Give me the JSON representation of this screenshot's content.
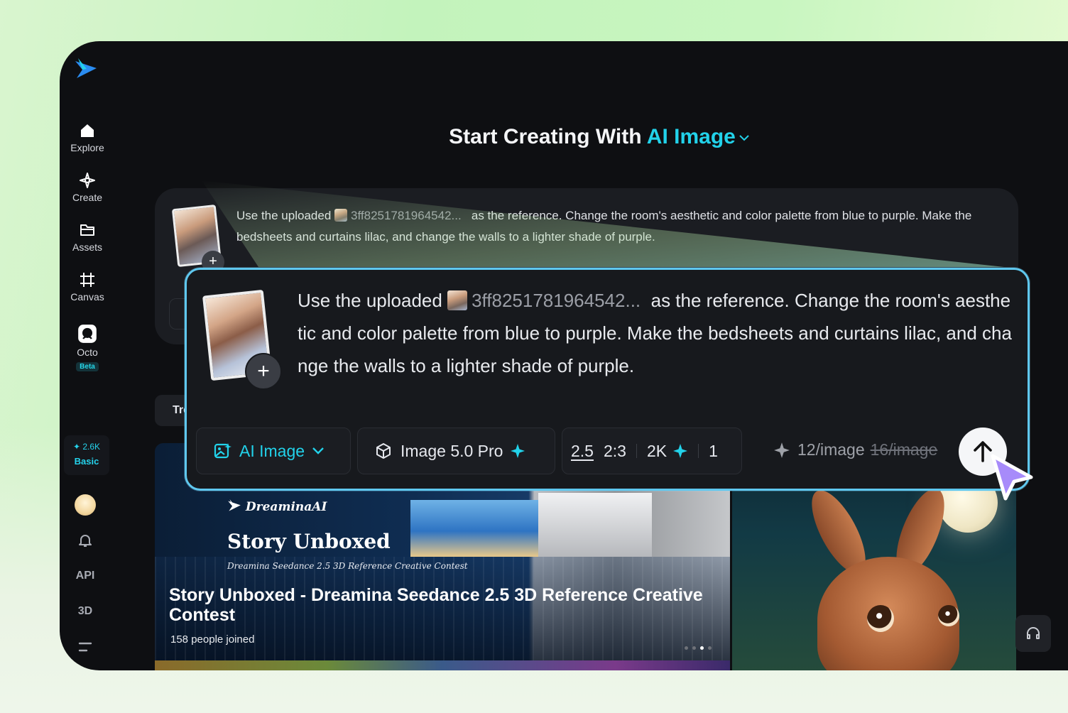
{
  "sidebar": {
    "nav": [
      {
        "label": "Explore",
        "icon": "home-icon"
      },
      {
        "label": "Create",
        "icon": "sparkle-outline-icon"
      },
      {
        "label": "Assets",
        "icon": "folder-icon"
      },
      {
        "label": "Canvas",
        "icon": "frame-icon"
      },
      {
        "label": "Octo",
        "icon": "octo-icon",
        "badge": "Beta"
      }
    ],
    "credits": {
      "amount": "2.6K",
      "plan": "Basic"
    },
    "api_label": "API",
    "threed_label": "3D"
  },
  "header": {
    "prefix": "Start Creating With",
    "mode": "AI Image"
  },
  "prompt": {
    "before_chip": "Use the uploaded",
    "chip": "3ff8251781964542...",
    "after_chip_back": "as the reference. Change the room's aesthetic and color palette from blue to purple. Make the bedsheets and curtains lilac, and change the walls to a lighter shade of purple.",
    "after_chip_zoom": "as the reference. Change the room's aesthetic and color palette from blue to purple. Make the bedsheets and curtains lilac, and change the walls to a lighter shade of purple."
  },
  "toolbar": {
    "mode_label": "AI Image",
    "model_label": "Image 5.0 Pro",
    "version": "2.5",
    "ratio": "2:3",
    "resolution": "2K",
    "count": "1",
    "price": "12/image",
    "old_price": "16/image"
  },
  "tabs": {
    "partial_label": "Tre"
  },
  "banner": {
    "brand": "DreaminaAI",
    "title": "Story Unboxed",
    "subtitle": "Dreamina Seedance 2.5 3D Reference Creative Contest",
    "headline": "Story Unboxed - Dreamina Seedance 2.5 3D Reference Creative Contest",
    "joined_count": "158",
    "joined_text": "people joined"
  },
  "colors": {
    "accent": "#22d2ea",
    "highlight_border": "#5fc8ef",
    "background": "#0e0f12"
  }
}
